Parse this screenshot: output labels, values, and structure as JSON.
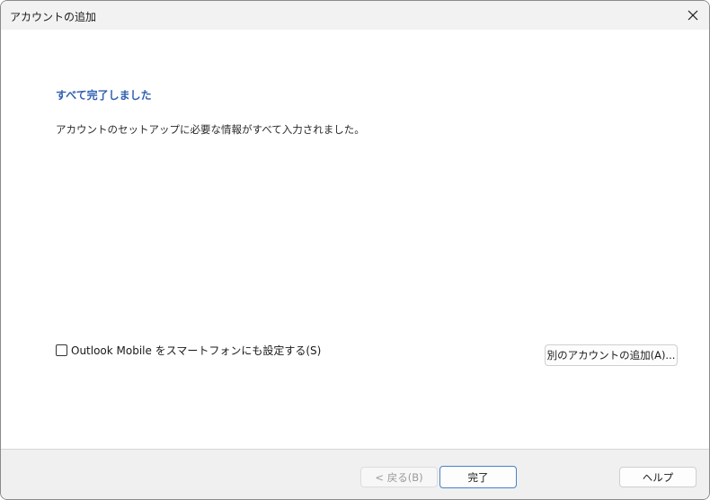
{
  "window": {
    "title": "アカウントの追加"
  },
  "main": {
    "heading": "すべて完了しました",
    "description": "アカウントのセットアップに必要な情報がすべて入力されました。",
    "mobile_checkbox": {
      "label": "Outlook Mobile をスマートフォンにも設定する(S)",
      "checked": false
    },
    "add_other_account_label": "別のアカウントの追加(A)..."
  },
  "footer": {
    "back_label": "< 戻る(B)",
    "finish_label": "完了",
    "help_label": "ヘルプ"
  },
  "colors": {
    "heading": "#2f5fb0",
    "primary_border": "#4a82c9",
    "footer_bg": "#f0f0f0"
  },
  "icons": {
    "close": "close-icon"
  }
}
